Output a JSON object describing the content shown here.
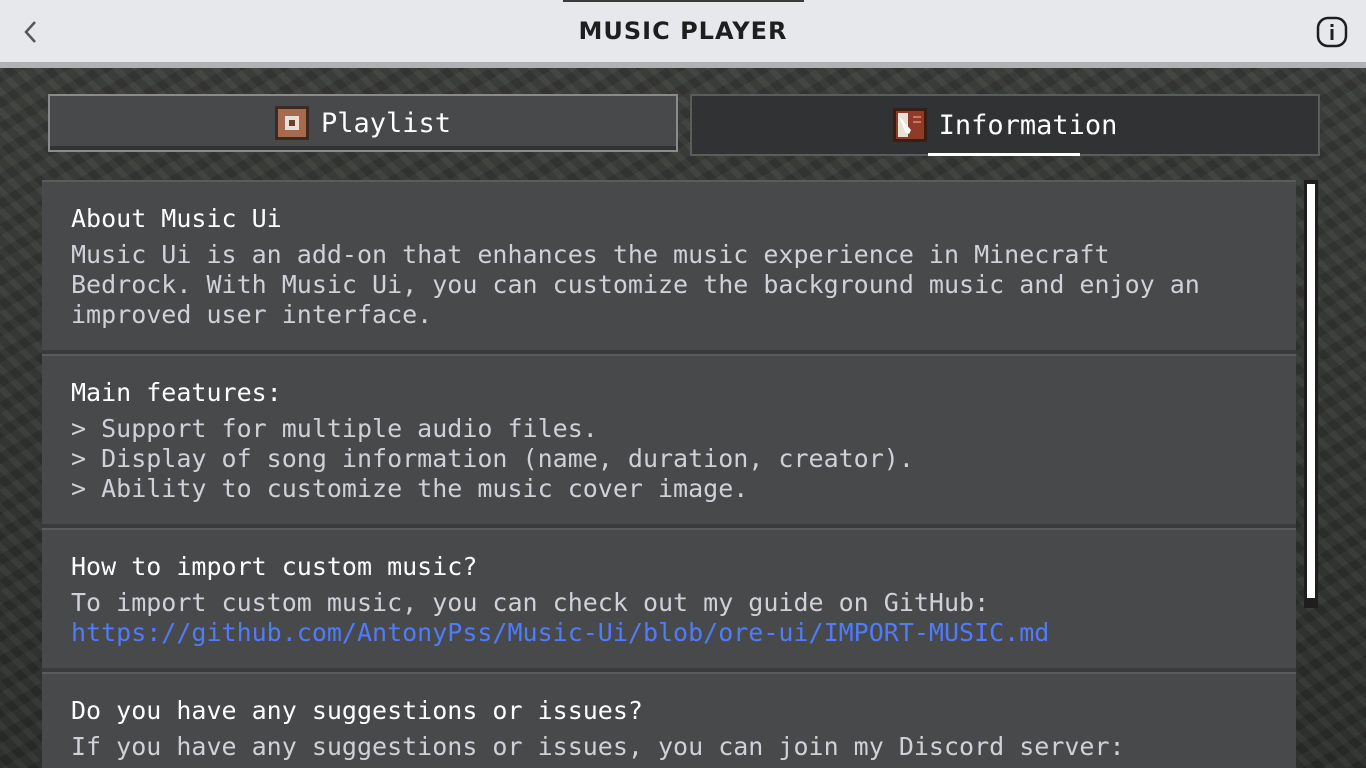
{
  "header": {
    "title": "MUSIC PLAYER",
    "back_icon": "chevron-left-icon",
    "info_icon": "info-icon"
  },
  "tabs": [
    {
      "label": "Playlist",
      "icon": "music-disc-icon",
      "selected": false
    },
    {
      "label": "Information",
      "icon": "book-quill-icon",
      "selected": true
    }
  ],
  "sections": {
    "about": {
      "heading": "About Music Ui",
      "lines": [
        "Music Ui is an add-on that enhances the music experience in Minecraft",
        "Bedrock. With Music Ui, you can customize the background music and enjoy an",
        "improved user interface."
      ]
    },
    "features": {
      "heading": "Main features:",
      "lines": [
        "> Support for multiple audio files.",
        "> Display of song information (name, duration, creator).",
        "> Ability to customize the music cover image."
      ]
    },
    "import": {
      "heading": "How to import custom music?",
      "line": "To import custom music, you can check out my guide on GitHub:",
      "link": "https://github.com/AntonyPss/Music-Ui/blob/ore-ui/IMPORT-MUSIC.md"
    },
    "suggestions": {
      "heading": "Do you have any suggestions or issues?",
      "line": "If you have any suggestions or issues, you can join my Discord server:"
    }
  },
  "colors": {
    "header_bg": "#e6e8eb",
    "tab_bg": "#48494a",
    "tab_selected_bg": "#313233",
    "section_bg": "#48494a",
    "link": "#4f7bff",
    "text": "#ffffff"
  }
}
